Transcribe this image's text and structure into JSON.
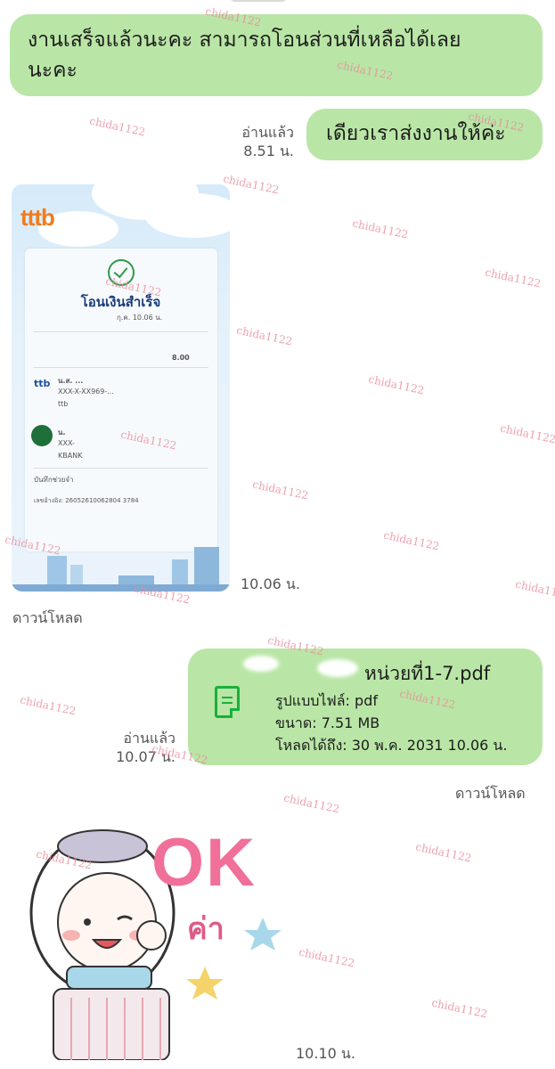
{
  "messages": {
    "incoming_1": {
      "text_line1": "งานเสร็จแล้วนะคะ สามารถโอนส่วนที่เหลือได้เลย",
      "text_line2": "นะคะ"
    },
    "outgoing_1": {
      "text": "เดียวเราส่งงานให้ค่ะ",
      "read_label": "อ่านแล้ว",
      "time": "8.51 น."
    },
    "slip_image": {
      "bank_logo": "ttb",
      "title": "โอนเงินสำเร็จ",
      "date_fragment": "กุ.ค. 10.06 น.",
      "amount_fragment": "8.00",
      "sender_name": "น.ส. ...",
      "sender_account": "XXX-X-XX969-...",
      "sender_bank": "ttb",
      "receiver_name": "น.",
      "receiver_account": "XXX-",
      "receiver_bank": "KBANK",
      "memo_label": "บันทึกช่วยจำ",
      "reference": "เลขอ้างอิง: 26052610062804 3784",
      "time": "10.06 น.",
      "download_label": "ดาวน์โหลด"
    },
    "file_message": {
      "filename": "หน่วยที่1-7.pdf",
      "format_line": "รูปแบบไฟล์: pdf",
      "size_line": "ขนาด: 7.51 MB",
      "expiry_line": "โหลดได้ถึง: 30 พ.ค. 2031 10.06 น.",
      "read_label": "อ่านแล้ว",
      "time": "10.07 น.",
      "download_label": "ดาวน์โหลด"
    },
    "sticker": {
      "text_ok": "OK",
      "text_ka": "ค่า",
      "time": "10.10 น."
    }
  },
  "watermark_text": "chida1122",
  "colors": {
    "bubble": "#b9e6a6",
    "file_icon": "#19b03a",
    "watermark": "#e88a9a",
    "sticker_pink": "#f0709a"
  }
}
